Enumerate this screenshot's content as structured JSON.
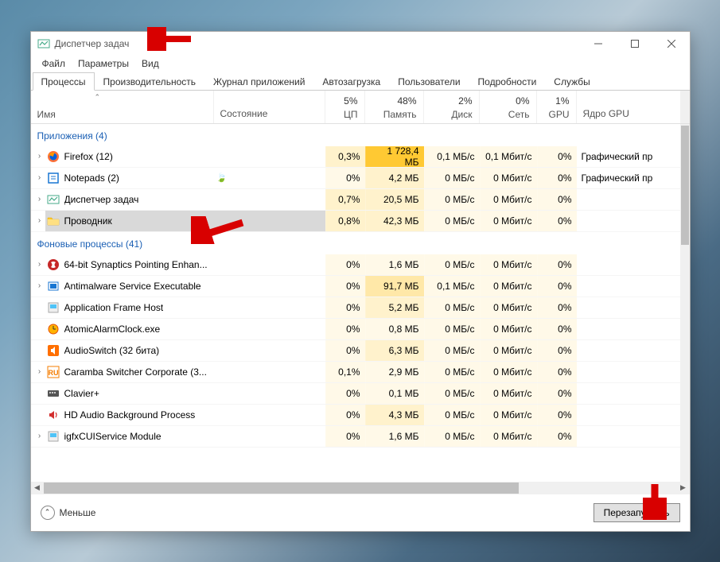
{
  "window": {
    "title": "Диспетчер задач"
  },
  "menus": [
    "Файл",
    "Параметры",
    "Вид"
  ],
  "tabs": [
    "Процессы",
    "Производительность",
    "Журнал приложений",
    "Автозагрузка",
    "Пользователи",
    "Подробности",
    "Службы"
  ],
  "columns": {
    "name": "Имя",
    "state": "Состояние",
    "cpu": {
      "pct": "5%",
      "label": "ЦП"
    },
    "mem": {
      "pct": "48%",
      "label": "Память"
    },
    "disk": {
      "pct": "2%",
      "label": "Диск"
    },
    "net": {
      "pct": "0%",
      "label": "Сеть"
    },
    "gpu": {
      "pct": "1%",
      "label": "GPU"
    },
    "gpueng": "Ядро GPU"
  },
  "sections": {
    "apps": "Приложения (4)",
    "bg": "Фоновые процессы (41)"
  },
  "apps": [
    {
      "name": "Firefox (12)",
      "cpu": "0,3%",
      "mem": "1 728,4 МБ",
      "disk": "0,1 МБ/с",
      "net": "0,1 Мбит/с",
      "gpu": "0%",
      "gpueng": "Графический пр",
      "icon": "firefox",
      "leaf": false
    },
    {
      "name": "Notepads (2)",
      "cpu": "0%",
      "mem": "4,2 МБ",
      "disk": "0 МБ/с",
      "net": "0 Мбит/с",
      "gpu": "0%",
      "gpueng": "Графический пр",
      "icon": "notepad",
      "leaf": true
    },
    {
      "name": "Диспетчер задач",
      "cpu": "0,7%",
      "mem": "20,5 МБ",
      "disk": "0 МБ/с",
      "net": "0 Мбит/с",
      "gpu": "0%",
      "gpueng": "",
      "icon": "taskmgr",
      "leaf": false
    },
    {
      "name": "Проводник",
      "cpu": "0,8%",
      "mem": "42,3 МБ",
      "disk": "0 МБ/с",
      "net": "0 Мбит/с",
      "gpu": "0%",
      "gpueng": "",
      "icon": "explorer",
      "leaf": false,
      "selected": true
    }
  ],
  "bg": [
    {
      "name": "64-bit Synaptics Pointing Enhan...",
      "cpu": "0%",
      "mem": "1,6 МБ",
      "disk": "0 МБ/с",
      "net": "0 Мбит/с",
      "gpu": "0%",
      "icon": "syn",
      "expandable": true
    },
    {
      "name": "Antimalware Service Executable",
      "cpu": "0%",
      "mem": "91,7 МБ",
      "disk": "0,1 МБ/с",
      "net": "0 Мбит/с",
      "gpu": "0%",
      "icon": "shield",
      "expandable": true
    },
    {
      "name": "Application Frame Host",
      "cpu": "0%",
      "mem": "5,2 МБ",
      "disk": "0 МБ/с",
      "net": "0 Мбит/с",
      "gpu": "0%",
      "icon": "app"
    },
    {
      "name": "AtomicAlarmClock.exe",
      "cpu": "0%",
      "mem": "0,8 МБ",
      "disk": "0 МБ/с",
      "net": "0 Мбит/с",
      "gpu": "0%",
      "icon": "clock"
    },
    {
      "name": "AudioSwitch (32 бита)",
      "cpu": "0%",
      "mem": "6,3 МБ",
      "disk": "0 МБ/с",
      "net": "0 Мбит/с",
      "gpu": "0%",
      "icon": "audio"
    },
    {
      "name": "Caramba Switcher Corporate (3...",
      "cpu": "0,1%",
      "mem": "2,9 МБ",
      "disk": "0 МБ/с",
      "net": "0 Мбит/с",
      "gpu": "0%",
      "icon": "caramba",
      "expandable": true
    },
    {
      "name": "Clavier+",
      "cpu": "0%",
      "mem": "0,1 МБ",
      "disk": "0 МБ/с",
      "net": "0 Мбит/с",
      "gpu": "0%",
      "icon": "keyboard"
    },
    {
      "name": "HD Audio Background Process",
      "cpu": "0%",
      "mem": "4,3 МБ",
      "disk": "0 МБ/с",
      "net": "0 Мбит/с",
      "gpu": "0%",
      "icon": "speaker"
    },
    {
      "name": "igfxCUIService Module",
      "cpu": "0%",
      "mem": "1,6 МБ",
      "disk": "0 МБ/с",
      "net": "0 Мбит/с",
      "gpu": "0%",
      "icon": "app",
      "expandable": true
    }
  ],
  "footer": {
    "less": "Меньше",
    "restart": "Перезапустить"
  }
}
